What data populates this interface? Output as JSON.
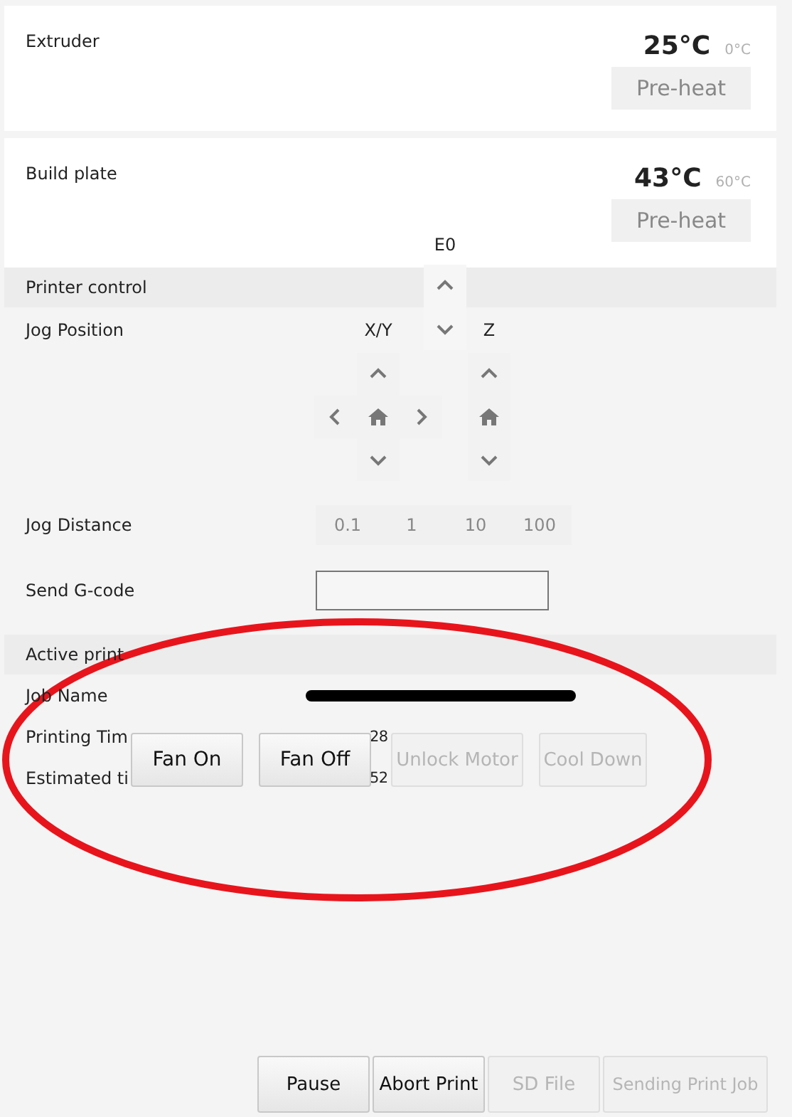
{
  "panels": [
    {
      "title": "Extruder",
      "temperature": "25°C",
      "target": "0°C",
      "button": {
        "label": "Pre-heat",
        "disabled": true
      }
    },
    {
      "title": "Build plate",
      "temperature": "43°C",
      "target": "60°C",
      "button": {
        "label": "Pre-heat",
        "disabled": true
      }
    }
  ],
  "extruder_jog": {
    "label": "E0"
  },
  "printer_control": {
    "title": "Printer control",
    "jog_position": {
      "label": "Jog Position",
      "xy_label": "X/Y",
      "z_label": "Z"
    },
    "jog_distance": {
      "label": "Jog Distance",
      "options": [
        {
          "label": "0.1",
          "selected": false
        },
        {
          "label": "1",
          "selected": false
        },
        {
          "label": "10",
          "selected": false
        },
        {
          "label": "100",
          "selected": false
        }
      ]
    },
    "send_gcode": {
      "label": "Send G-code"
    }
  },
  "active_print": {
    "title": "Active print",
    "rows": [
      {
        "label": "Job Name",
        "kind": "redacted"
      },
      {
        "label": "Printing Tim",
        "kind": "text",
        "value": "28"
      },
      {
        "label": "Estimated ti",
        "kind": "text",
        "value": "52"
      }
    ]
  },
  "overlay_buttons": [
    {
      "label": "Fan On",
      "disabled": false
    },
    {
      "label": "Fan Off",
      "disabled": false
    },
    {
      "label": "Unlock Motor",
      "disabled": true
    },
    {
      "label": "Cool Down",
      "disabled": true
    }
  ],
  "actions": [
    {
      "label": "Pause",
      "disabled": false
    },
    {
      "label": "Abort Print",
      "disabled": false
    },
    {
      "label": "SD File",
      "disabled": true
    },
    {
      "label": "Sending Print Job",
      "disabled": true
    }
  ],
  "annotation": {
    "kind": "ellipse"
  }
}
